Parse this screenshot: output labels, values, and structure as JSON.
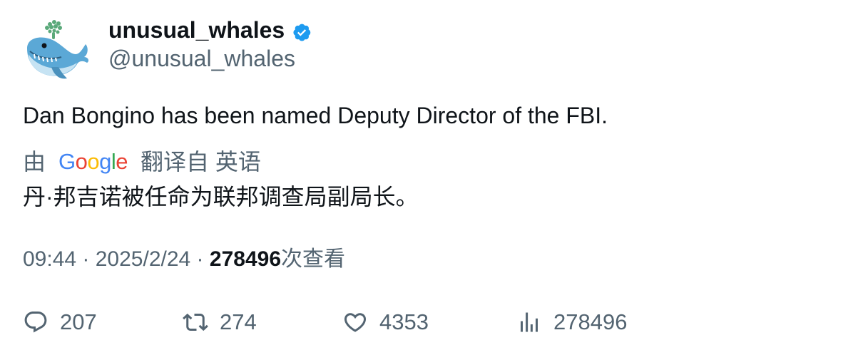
{
  "author": {
    "display_name": "unusual_whales",
    "handle": "@unusual_whales",
    "verified": true,
    "avatar_icon": "whale-icon"
  },
  "tweet": {
    "text": "Dan Bongino has been named Deputy Director of the FBI.",
    "translation": {
      "prefix": "由",
      "provider": "Google",
      "suffix": "翻译自 英语",
      "text": "丹·邦吉诺被任命为联邦调查局副局长。"
    }
  },
  "meta": {
    "time": "09:44",
    "separator": " · ",
    "date": "2025/2/24",
    "views": "278496",
    "views_label": "次查看"
  },
  "actions": {
    "replies": "207",
    "reposts": "274",
    "likes": "4353",
    "views": "278496"
  },
  "colors": {
    "verified_badge": "#1d9bf0",
    "secondary_text": "#536471",
    "primary_text": "#0f1419"
  }
}
